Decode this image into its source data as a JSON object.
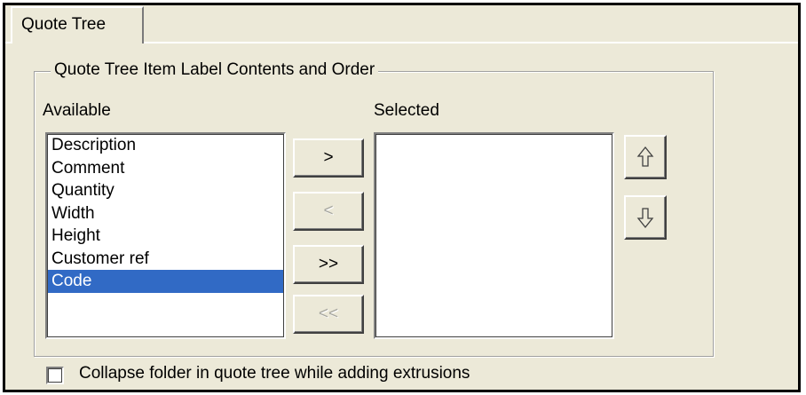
{
  "tab": {
    "label": "Quote Tree"
  },
  "group": {
    "title": "Quote Tree Item Label Contents and Order"
  },
  "available": {
    "label": "Available",
    "items": [
      "Description",
      "Comment",
      "Quantity",
      "Width",
      "Height",
      "Customer ref",
      "Code"
    ],
    "selected_item": "Code"
  },
  "selected": {
    "label": "Selected",
    "items": []
  },
  "buttons": {
    "add": ">",
    "remove": "<",
    "add_all": ">>",
    "remove_all": "<<"
  },
  "icons": {
    "move_up": "up-arrow-icon",
    "move_down": "down-arrow-icon"
  },
  "collapse_checkbox": {
    "label": "Collapse folder in quote tree while adding extrusions",
    "checked": false
  },
  "colors": {
    "selection": "#316ac5",
    "panel": "#ece9d8"
  }
}
